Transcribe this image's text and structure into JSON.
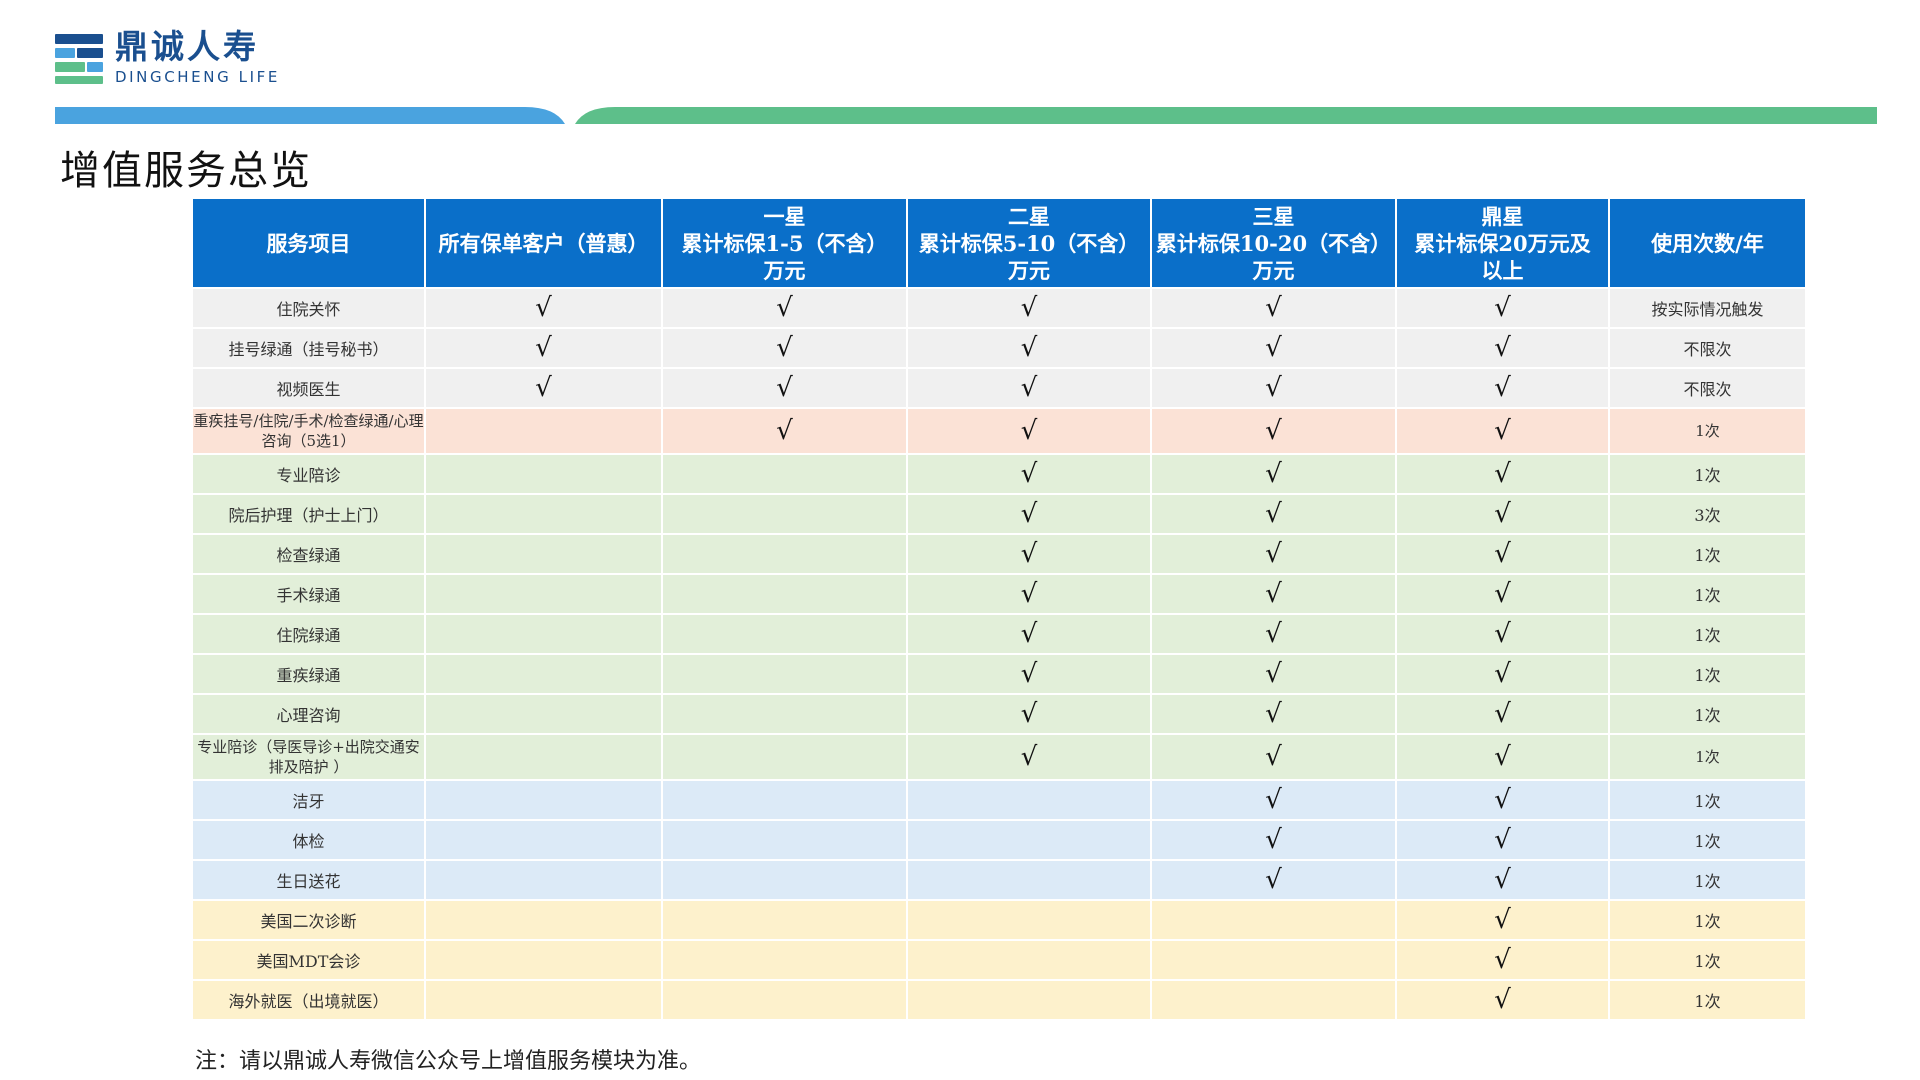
{
  "logo": {
    "name_cn": "鼎诚人寿",
    "name_en": "DINGCHENG LIFE"
  },
  "colors": {
    "header_blue": "#0a6fc9",
    "bar_blue": "#4aa3df",
    "bar_green": "#5dbf8a"
  },
  "page": {
    "title": "增值服务总览"
  },
  "check_mark": "√",
  "table": {
    "headers": [
      {
        "lines": [
          "服务项目"
        ]
      },
      {
        "lines": [
          "所有保单客户（普惠）"
        ]
      },
      {
        "lines": [
          "一星",
          "累计标保1-5（不含）",
          "万元"
        ]
      },
      {
        "lines": [
          "二星",
          "累计标保5-10（不含）",
          "万元"
        ]
      },
      {
        "lines": [
          "三星",
          "累计标保10-20（不含）",
          "万元"
        ]
      },
      {
        "lines": [
          "鼎星",
          "累计标保20万元及",
          "以上"
        ]
      },
      {
        "lines": [
          "使用次数/年"
        ]
      }
    ],
    "rows": [
      {
        "group": "grey",
        "item": "住院关怀",
        "checks": [
          true,
          true,
          true,
          true,
          true
        ],
        "count": "按实际情况触发"
      },
      {
        "group": "grey",
        "item": "挂号绿通（挂号秘书）",
        "checks": [
          true,
          true,
          true,
          true,
          true
        ],
        "count": "不限次"
      },
      {
        "group": "grey",
        "item": "视频医生",
        "checks": [
          true,
          true,
          true,
          true,
          true
        ],
        "count": "不限次"
      },
      {
        "group": "pink",
        "item": "重疾挂号/住院/手术/检查绿通/心理咨询（5选1）",
        "checks": [
          false,
          true,
          true,
          true,
          true
        ],
        "count": "1次"
      },
      {
        "group": "green",
        "item": "专业陪诊",
        "checks": [
          false,
          false,
          true,
          true,
          true
        ],
        "count": "1次"
      },
      {
        "group": "green",
        "item": "院后护理（护士上门）",
        "checks": [
          false,
          false,
          true,
          true,
          true
        ],
        "count": "3次"
      },
      {
        "group": "green",
        "item": "检查绿通",
        "checks": [
          false,
          false,
          true,
          true,
          true
        ],
        "count": "1次"
      },
      {
        "group": "green",
        "item": "手术绿通",
        "checks": [
          false,
          false,
          true,
          true,
          true
        ],
        "count": "1次"
      },
      {
        "group": "green",
        "item": "住院绿通",
        "checks": [
          false,
          false,
          true,
          true,
          true
        ],
        "count": "1次"
      },
      {
        "group": "green",
        "item": "重疾绿通",
        "checks": [
          false,
          false,
          true,
          true,
          true
        ],
        "count": "1次"
      },
      {
        "group": "green",
        "item": "心理咨询",
        "checks": [
          false,
          false,
          true,
          true,
          true
        ],
        "count": "1次"
      },
      {
        "group": "green",
        "item": "专业陪诊（导医导诊+出院交通安排及陪护 ）",
        "checks": [
          false,
          false,
          true,
          true,
          true
        ],
        "count": "1次"
      },
      {
        "group": "blue",
        "item": "洁牙",
        "checks": [
          false,
          false,
          false,
          true,
          true
        ],
        "count": "1次"
      },
      {
        "group": "blue",
        "item": "体检",
        "checks": [
          false,
          false,
          false,
          true,
          true
        ],
        "count": "1次"
      },
      {
        "group": "blue",
        "item": "生日送花",
        "checks": [
          false,
          false,
          false,
          true,
          true
        ],
        "count": "1次"
      },
      {
        "group": "yellow",
        "item": "美国二次诊断",
        "checks": [
          false,
          false,
          false,
          false,
          true
        ],
        "count": "1次"
      },
      {
        "group": "yellow",
        "item": "美国MDT会诊",
        "checks": [
          false,
          false,
          false,
          false,
          true
        ],
        "count": "1次"
      },
      {
        "group": "yellow",
        "item": "海外就医（出境就医）",
        "checks": [
          false,
          false,
          false,
          false,
          true
        ],
        "count": "1次"
      }
    ]
  },
  "note": "注：请以鼎诚人寿微信公众号上增值服务模块为准。"
}
